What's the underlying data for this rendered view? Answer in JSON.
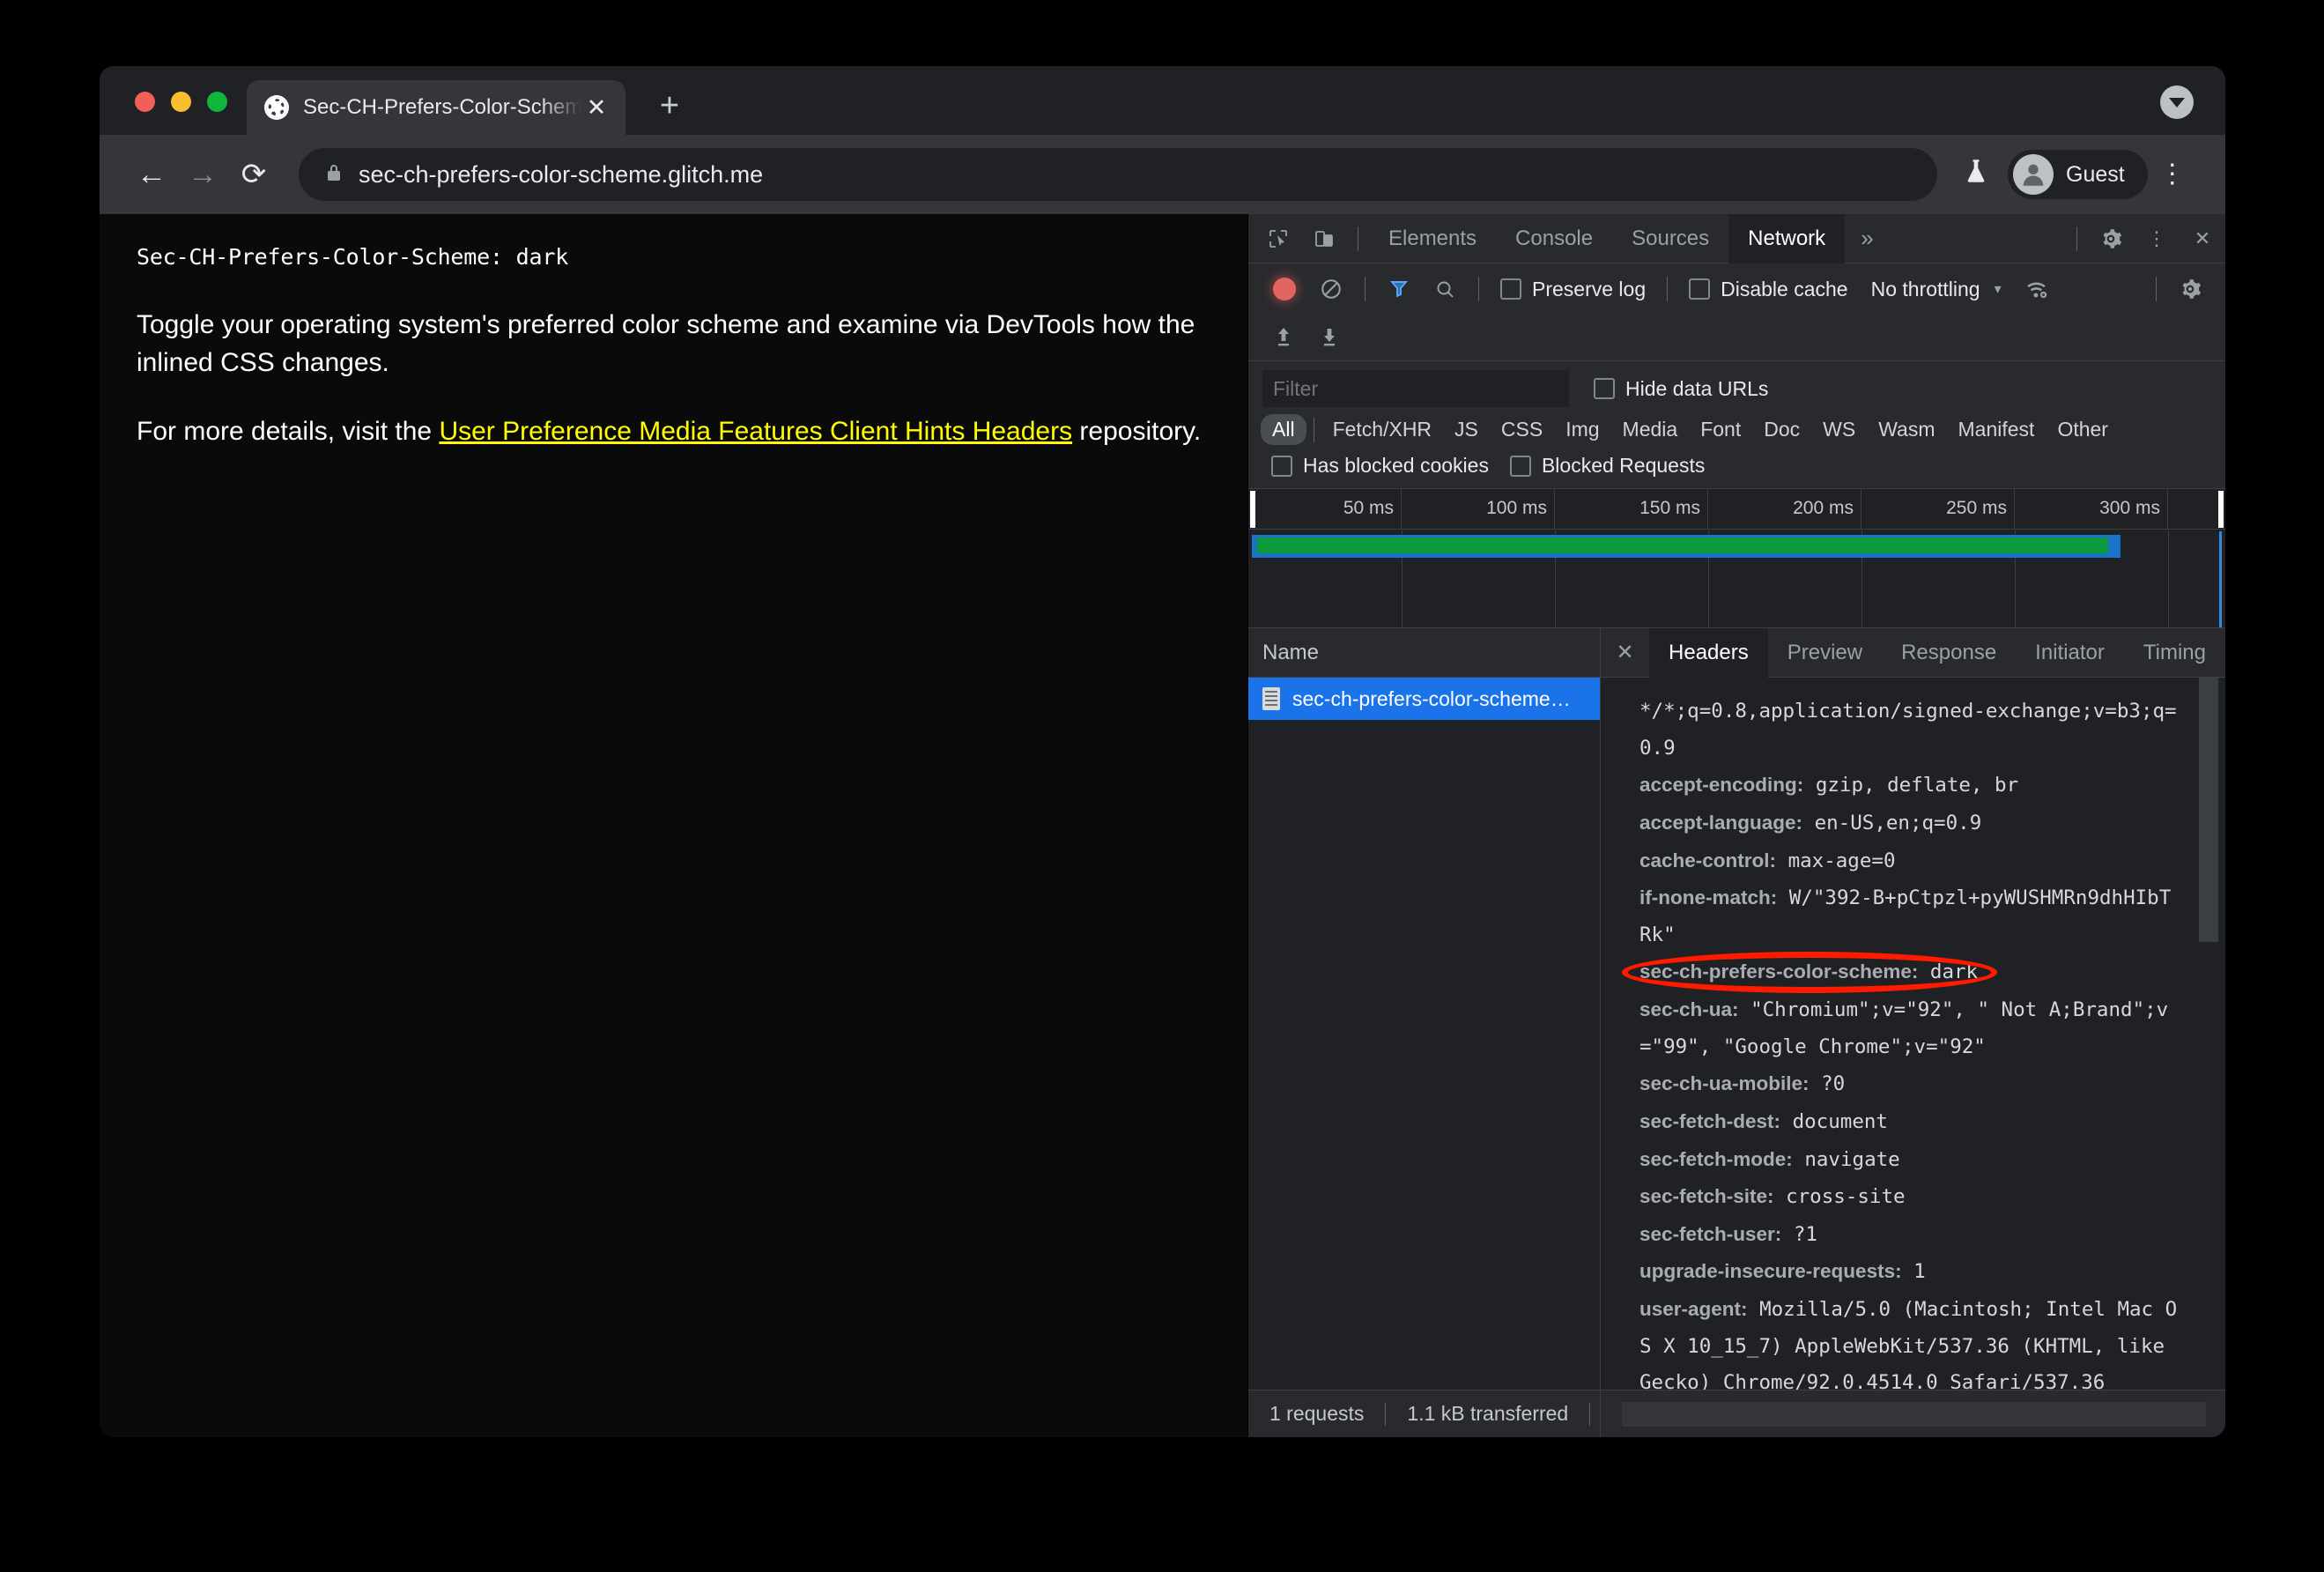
{
  "browser": {
    "tab": {
      "title": "Sec-CH-Prefers-Color-Scheme",
      "favicon": "globe-icon",
      "close": "✕"
    },
    "new_tab": "+",
    "tabstrip_menu": "chevron-down-icon",
    "nav": {
      "back": "←",
      "forward": "→",
      "reload": "⟳"
    },
    "omnibox": {
      "lock": "🔒",
      "url": "sec-ch-prefers-color-scheme.glitch.me"
    },
    "flask": "⚗",
    "profile": {
      "label": "Guest",
      "avatar": "●"
    },
    "menu": "⋮"
  },
  "page": {
    "header_line": "Sec-CH-Prefers-Color-Scheme: dark",
    "paragraph1": "Toggle your operating system's preferred color scheme and examine via DevTools how the inlined CSS changes.",
    "paragraph2_before": "For more details, visit the ",
    "paragraph2_link": "User Preference Media Features Client Hints Headers",
    "paragraph2_after": " repository."
  },
  "devtools": {
    "icons": {
      "inspect": "inspect-element-icon",
      "device": "device-toolbar-icon",
      "settings": "⚙",
      "kebab": "⋮",
      "close": "✕"
    },
    "panels": [
      "Elements",
      "Console",
      "Sources",
      "Network"
    ],
    "active_panel": "Network",
    "more_panels": "»",
    "network_toolbar": {
      "record": "record-button",
      "clear": "⊘",
      "filter_icon": "funnel-icon",
      "search_icon": "⌕",
      "preserve_log": "Preserve log",
      "preserve_log_checked": false,
      "disable_cache": "Disable cache",
      "disable_cache_checked": false,
      "throttling": "No throttling",
      "throttle_caret": "▾",
      "network_conditions": "wifi-settings-icon",
      "settings": "⚙",
      "import_har": "import-har-icon",
      "export_har": "export-har-icon"
    },
    "filterbar": {
      "filter_placeholder": "Filter",
      "filter_value": "",
      "hide_data_urls": "Hide data URLs",
      "hide_data_urls_checked": false,
      "types": [
        "All",
        "Fetch/XHR",
        "JS",
        "CSS",
        "Img",
        "Media",
        "Font",
        "Doc",
        "WS",
        "Wasm",
        "Manifest",
        "Other"
      ],
      "selected_type": "All",
      "has_blocked_cookies": "Has blocked cookies",
      "has_blocked_cookies_checked": false,
      "blocked_requests": "Blocked Requests",
      "blocked_requests_checked": false
    },
    "overview": {
      "ticks": [
        "50 ms",
        "100 ms",
        "150 ms",
        "200 ms",
        "250 ms",
        "300 ms"
      ],
      "bar_color": "#1a73c8",
      "bar_inner_color": "#0b9a3c"
    },
    "requests": {
      "column_header": "Name",
      "rows": [
        {
          "name": "sec-ch-prefers-color-scheme…",
          "icon": "document-icon",
          "selected": true
        }
      ]
    },
    "detail_tabs": [
      "Headers",
      "Preview",
      "Response",
      "Initiator",
      "Timing"
    ],
    "active_detail_tab": "Headers",
    "detail_close": "✕",
    "headers": [
      {
        "name": "",
        "value": "*/*;q=0.8,application/signed-exchange;v=b3;q=0.9",
        "highlighted": false
      },
      {
        "name": "accept-encoding:",
        "value": " gzip, deflate, br",
        "highlighted": false
      },
      {
        "name": "accept-language:",
        "value": " en-US,en;q=0.9",
        "highlighted": false
      },
      {
        "name": "cache-control:",
        "value": " max-age=0",
        "highlighted": false
      },
      {
        "name": "if-none-match:",
        "value": " W/\"392-B+pCtpzl+pyWUSHMRn9dhHIbTRk\"",
        "highlighted": false
      },
      {
        "name": "sec-ch-prefers-color-scheme:",
        "value": " dark",
        "highlighted": true
      },
      {
        "name": "sec-ch-ua:",
        "value": " \"Chromium\";v=\"92\", \" Not A;Brand\";v=\"99\", \"Google Chrome\";v=\"92\"",
        "highlighted": false
      },
      {
        "name": "sec-ch-ua-mobile:",
        "value": " ?0",
        "highlighted": false
      },
      {
        "name": "sec-fetch-dest:",
        "value": " document",
        "highlighted": false
      },
      {
        "name": "sec-fetch-mode:",
        "value": " navigate",
        "highlighted": false
      },
      {
        "name": "sec-fetch-site:",
        "value": " cross-site",
        "highlighted": false
      },
      {
        "name": "sec-fetch-user:",
        "value": " ?1",
        "highlighted": false
      },
      {
        "name": "upgrade-insecure-requests:",
        "value": " 1",
        "highlighted": false
      },
      {
        "name": "user-agent:",
        "value": " Mozilla/5.0 (Macintosh; Intel Mac OS X 10_15_7) AppleWebKit/537.36 (KHTML, like Gecko) Chrome/92.0.4514.0 Safari/537.36",
        "highlighted": false
      }
    ],
    "statusbar": {
      "requests": "1 requests",
      "transferred": "1.1 kB transferred"
    }
  },
  "annotation": {
    "color": "#ff1a00",
    "target": "sec-ch-prefers-color-scheme: dark"
  }
}
